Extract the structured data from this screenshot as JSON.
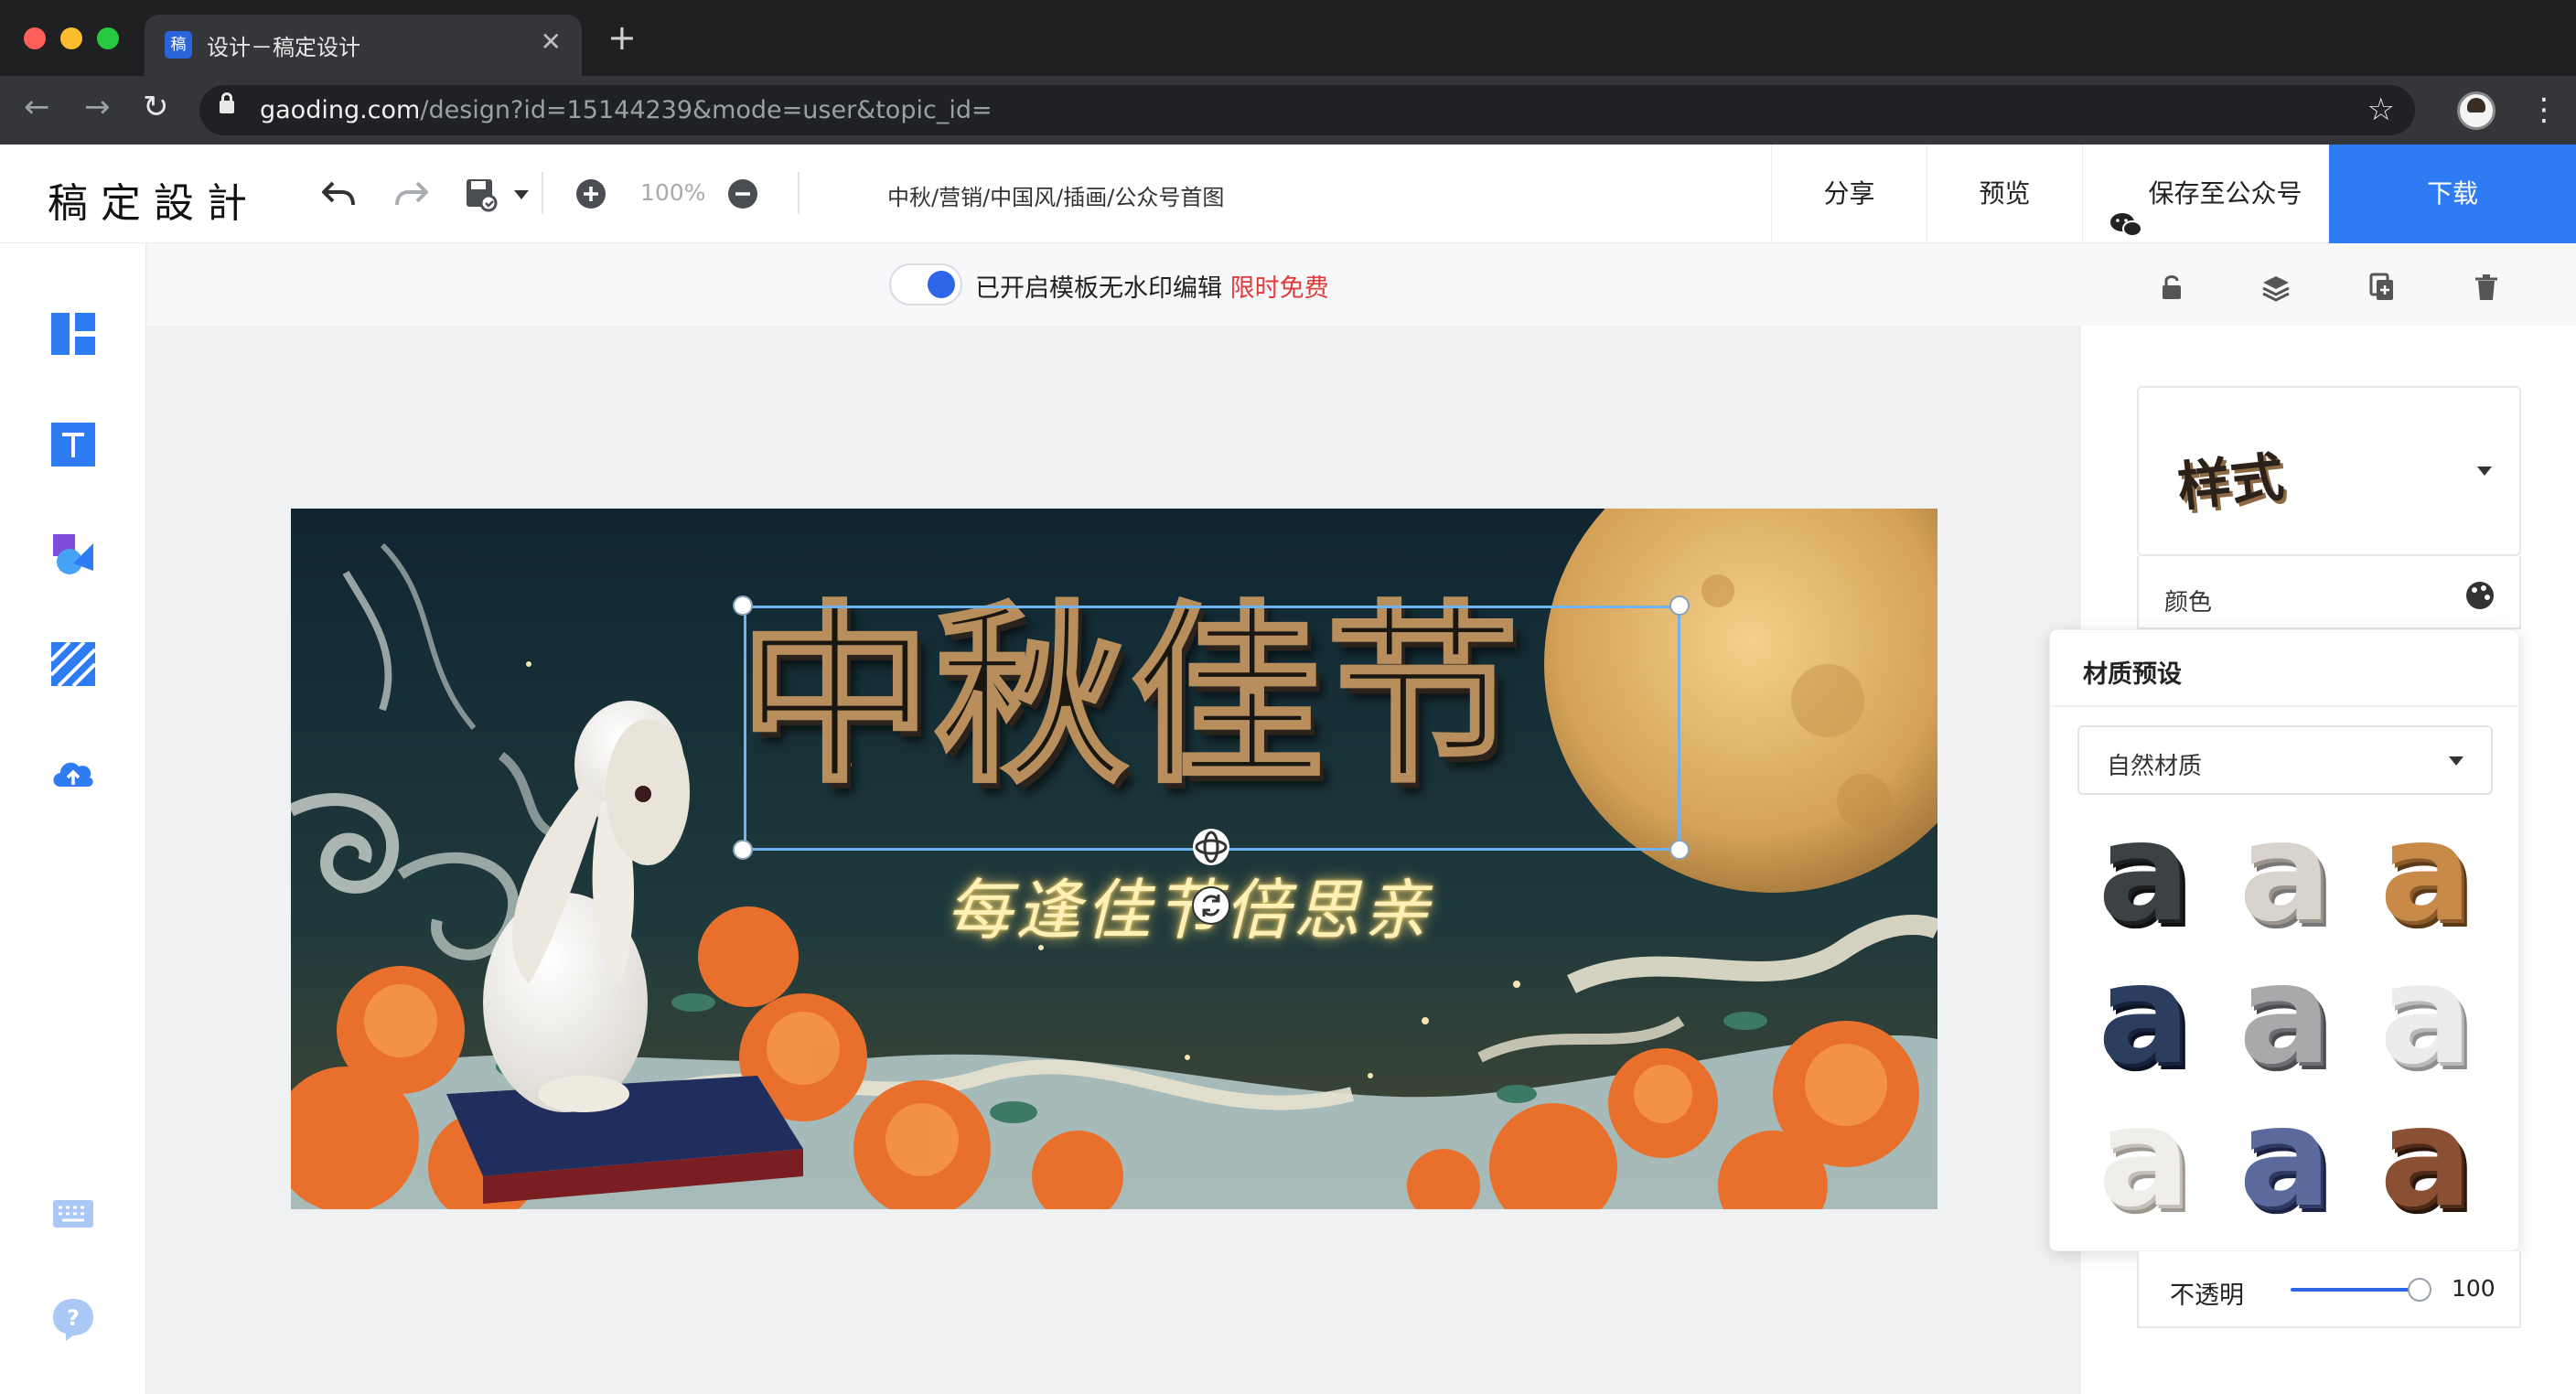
{
  "browser": {
    "tab_title": "设计－稿定设计",
    "tab_favicon_text": "稿",
    "url_host": "gaoding.com",
    "url_path": "/design?id=15144239&mode=user&topic_id="
  },
  "header": {
    "logo": "稿定設計",
    "zoom_level": "100%",
    "breadcrumb": "中秋/营销/中国风/插画/公众号首图",
    "share_label": "分享",
    "preview_label": "预览",
    "save_wechat_label": "保存至公众号",
    "download_label": "下载"
  },
  "toolbar": {
    "toggle_text": "已开启模板无水印编辑",
    "toggle_free_text": "限时免费",
    "toggle_on": true
  },
  "poster": {
    "title": "中秋佳节",
    "subtitle": "每逢佳节倍思亲"
  },
  "right_panel": {
    "style_label": "样式",
    "color_label": "颜色",
    "material_title": "材质预设",
    "material_selected": "自然材质",
    "swatch_letter": "a",
    "opacity_label": "不透明",
    "opacity_value": "100"
  },
  "colors": {
    "accent": "#2f7bf4",
    "free_text": "#e03a3a",
    "selection": "#6fb3f0"
  }
}
